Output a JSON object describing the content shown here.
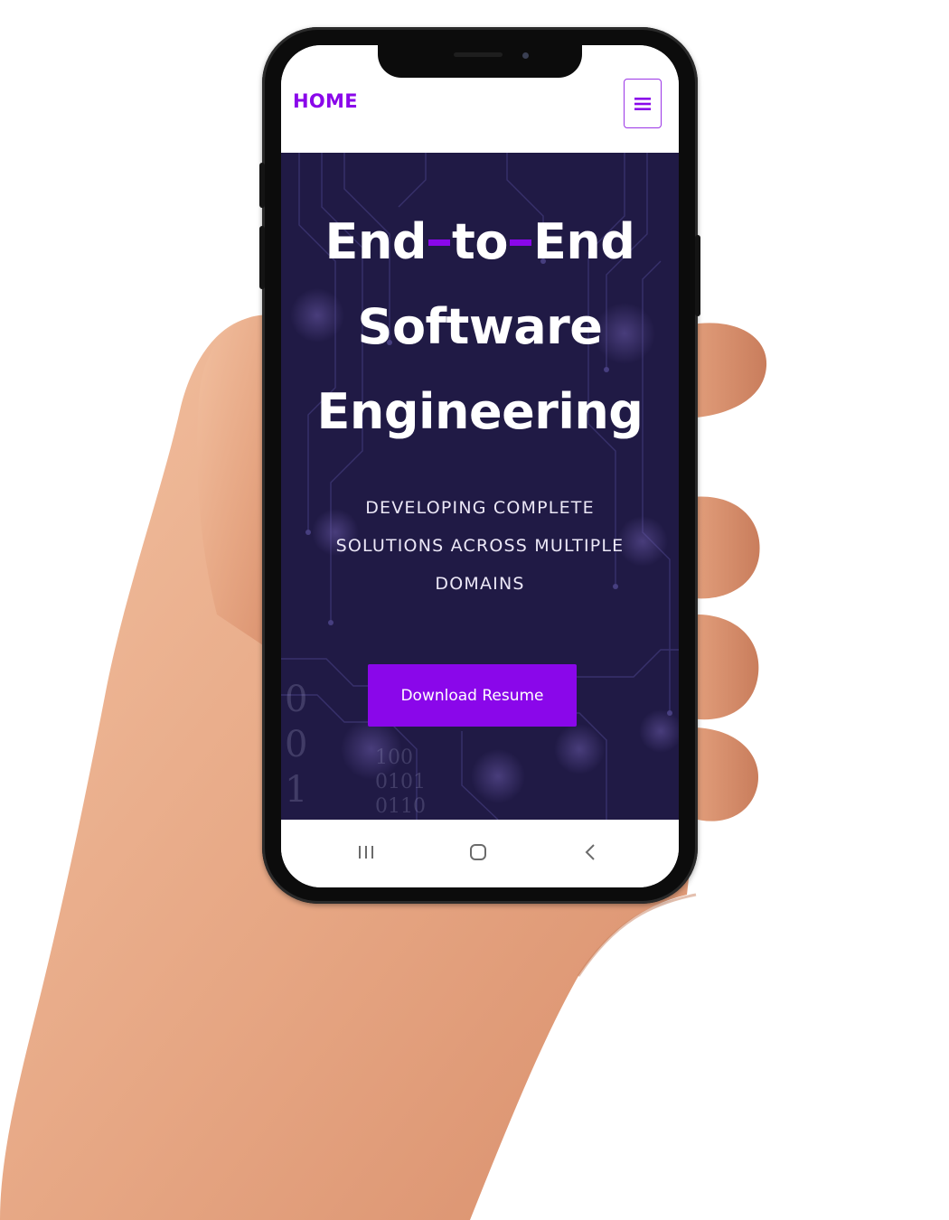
{
  "navbar": {
    "brand": "HOME",
    "menu_icon": "hamburger-menu-icon"
  },
  "hero": {
    "title_lines": [
      "End",
      "to",
      "End",
      "Software",
      "Engineering"
    ],
    "subtitle_lines": [
      "DEVELOPING COMPLETE",
      "SOLUTIONS ACROSS MULTIPLE",
      "DOMAINS"
    ],
    "cta_label": "Download Resume",
    "binary_left": [
      "0",
      "0",
      "1"
    ],
    "binary_right": [
      "100",
      "0101",
      "0110"
    ]
  },
  "system_nav": {
    "recents_icon": "recent-apps-icon",
    "home_icon": "home-circle-icon",
    "back_icon": "back-chevron-icon"
  },
  "colors": {
    "accent": "#8a07ea",
    "hero_background": "#201a45",
    "text_light": "#ffffff"
  }
}
